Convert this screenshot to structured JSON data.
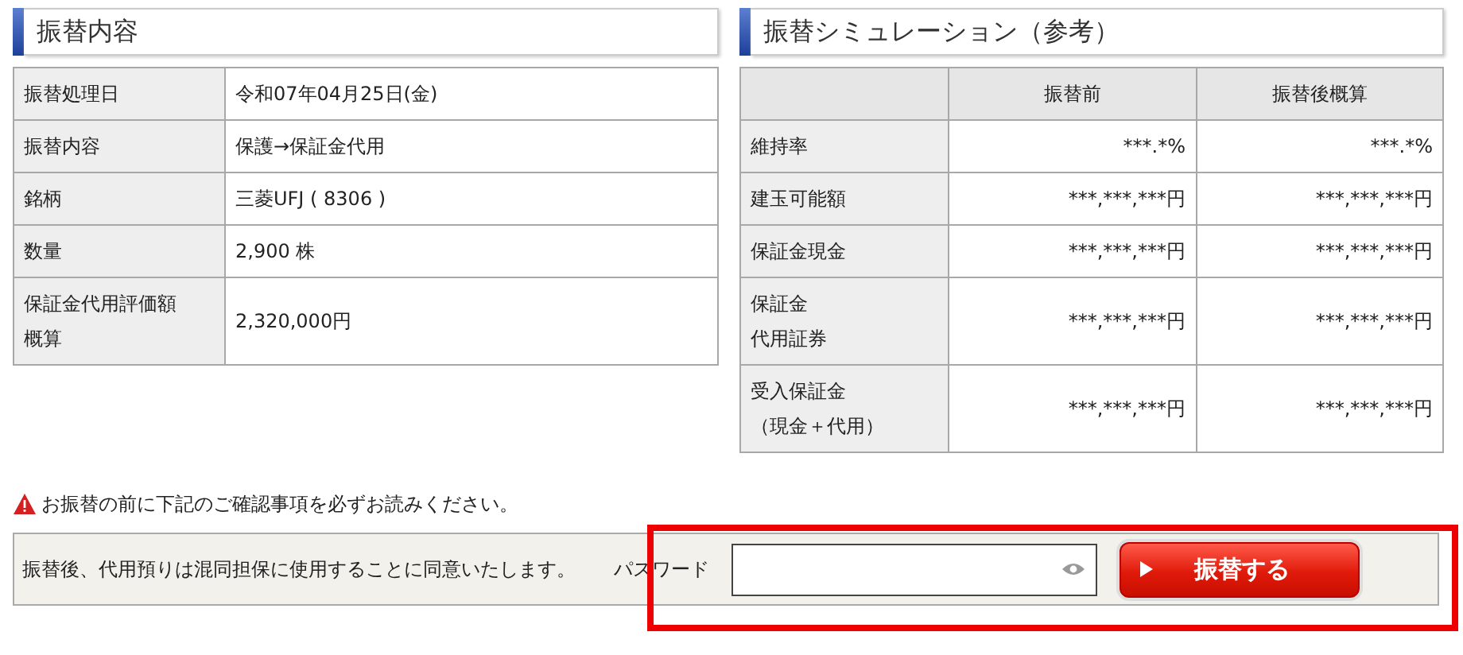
{
  "left_panel": {
    "title": "振替内容",
    "rows": [
      {
        "label": [
          "振替処理日"
        ],
        "value": "令和07年04月25日(金)"
      },
      {
        "label": [
          "振替内容"
        ],
        "value": "保護→保証金代用"
      },
      {
        "label": [
          "銘柄"
        ],
        "value": "三菱UFJ ( 8306 )"
      },
      {
        "label": [
          "数量"
        ],
        "value": "2,900 株"
      },
      {
        "label": [
          "保証金代用評価額",
          "概算"
        ],
        "value": "2,320,000円"
      }
    ]
  },
  "right_panel": {
    "title": "振替シミュレーション（参考）",
    "columns": [
      "振替前",
      "振替後概算"
    ],
    "rows": [
      {
        "label": [
          "維持率"
        ],
        "before": "***.*%",
        "after": "***.*%"
      },
      {
        "label": [
          "建玉可能額"
        ],
        "before": "***,***,***円",
        "after": "***,***,***円"
      },
      {
        "label": [
          "保証金現金"
        ],
        "before": "***,***,***円",
        "after": "***,***,***円"
      },
      {
        "label": [
          "保証金",
          "代用証券"
        ],
        "before": "***,***,***円",
        "after": "***,***,***円"
      },
      {
        "label": [
          "受入保証金",
          "（現金＋代用）"
        ],
        "before": "***,***,***円",
        "after": "***,***,***円"
      }
    ]
  },
  "notice": "お振替の前に下記のご確認事項を必ずお読みください。",
  "agreement": {
    "text": "振替後、代用預りは混同担保に使用することに同意いたします。",
    "password_label": "パスワード",
    "submit_button": "振替する"
  }
}
